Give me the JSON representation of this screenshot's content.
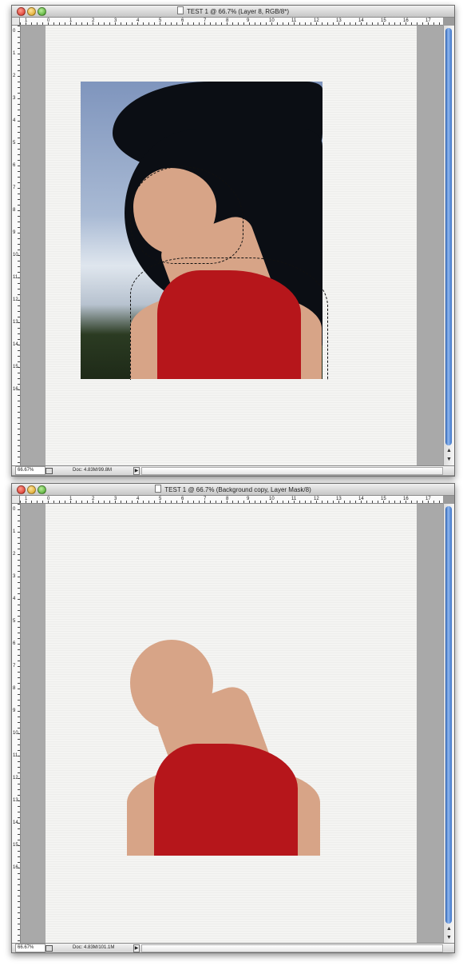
{
  "windows": [
    {
      "title": "TEST 1 @ 66.7% (Layer 8, RGB/8*)",
      "ruler_numbers": [
        "1",
        "0",
        "1",
        "2",
        "3",
        "4",
        "5",
        "6",
        "7",
        "8",
        "9",
        "10",
        "11",
        "12",
        "13",
        "14",
        "15",
        "16",
        "17"
      ],
      "zoom": "66.67%",
      "doc_info": "Doc: 4.83M/99.8M",
      "has_selection": true
    },
    {
      "title": "TEST 1 @ 66.7% (Background copy, Layer Mask/8)",
      "ruler_numbers": [
        "1",
        "0",
        "1",
        "2",
        "3",
        "4",
        "5",
        "6",
        "7",
        "8",
        "9",
        "10",
        "11",
        "12",
        "13",
        "14",
        "15",
        "16",
        "17"
      ],
      "zoom": "66.67%",
      "doc_info": "Doc: 4.83M/101.1M",
      "has_selection": false
    }
  ],
  "colors": {
    "shirt": "#b6161b",
    "hair": "#0b0e14",
    "skin": "#d7a487",
    "sky": "#a9bad4",
    "canvas": "#f4f4f2",
    "pasteboard": "#a9a9a9",
    "scroll_accent": "#3c73c6"
  },
  "icons": [
    "close-button",
    "minimize-button",
    "zoom-button",
    "document-icon",
    "scroll-up-icon",
    "scroll-down-icon"
  ]
}
